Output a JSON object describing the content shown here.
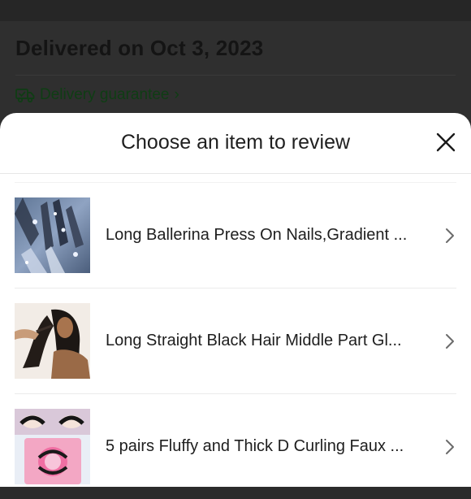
{
  "background": {
    "delivered_text": "Delivered on Oct 3, 2023",
    "guarantee_text": "Delivery guarantee",
    "guarantee_chevron": "›",
    "guarantee_icon": "truck-check-icon"
  },
  "sheet": {
    "title": "Choose an item to review",
    "close_icon": "close-icon",
    "items": [
      {
        "title": "Long Ballerina Press On Nails,Gradient ...",
        "image": "nails-product-image",
        "chevron_icon": "chevron-right-icon"
      },
      {
        "title": "Long Straight Black Hair Middle Part Gl...",
        "image": "wig-product-image",
        "chevron_icon": "chevron-right-icon"
      },
      {
        "title": "5 pairs Fluffy and Thick D Curling Faux ...",
        "image": "eyelashes-product-image",
        "chevron_icon": "chevron-right-icon"
      }
    ]
  },
  "colors": {
    "overlay": "#2f2f2f",
    "sheet": "#ffffff",
    "guarantee_green": "#0f3d14",
    "text": "#1f1f1f"
  }
}
